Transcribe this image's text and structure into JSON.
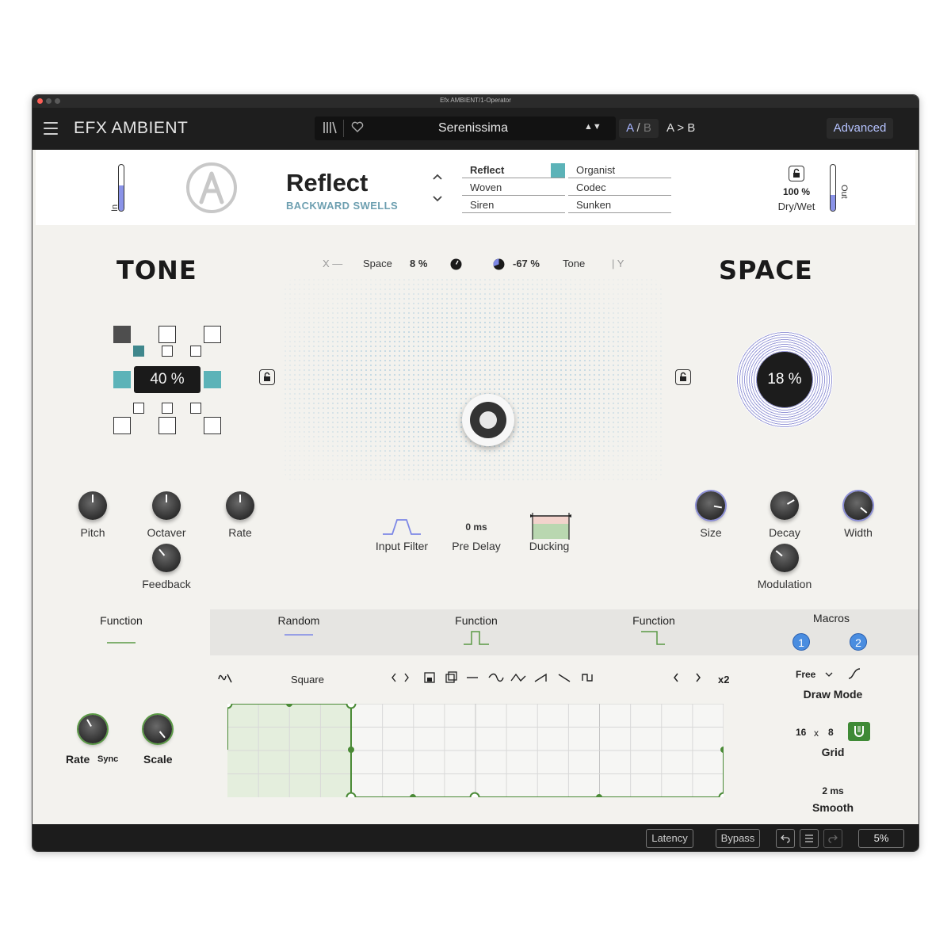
{
  "window": {
    "title": "Efx AMBIENT/1-Operator"
  },
  "topbar": {
    "app_title_prefix": "EFX",
    "app_title_name": "AMBIENT",
    "preset_name": "Serenissima",
    "preset_arrows": "▲▼",
    "ab_a": "A",
    "ab_sep": "/",
    "ab_b": "B",
    "a_to_b": "A > B",
    "advanced": "Advanced"
  },
  "header": {
    "in_label": "In",
    "in_level": 0.55,
    "mode_name": "Reflect",
    "mode_sub": "BACKWARD SWELLS",
    "mode_up": "˄",
    "mode_down": "˅",
    "modes_left": [
      "Reflect",
      "Woven",
      "Siren"
    ],
    "modes_right": [
      "Organist",
      "Codec",
      "Sunken"
    ],
    "selected_mode": "Reflect",
    "drywet_value": "100 %",
    "drywet_label": "Dry/Wet",
    "out_label": "Out",
    "out_level": 0.35
  },
  "main": {
    "tone_title": "TONE",
    "space_title": "SPACE",
    "xy": {
      "x_label": "X —",
      "space_label": "Space",
      "space_value": "8 %",
      "tone_value": "-67 %",
      "tone_label": "Tone",
      "y_label": "| Y"
    },
    "tone_value": "40 %",
    "space_value": "18 %",
    "tone_knobs": [
      {
        "label": "Pitch"
      },
      {
        "label": "Octaver"
      },
      {
        "label": "Rate"
      },
      {
        "label": "Feedback"
      }
    ],
    "middle": {
      "input_filter": "Input Filter",
      "predelay_value": "0 ms",
      "predelay_label": "Pre Delay",
      "ducking": "Ducking"
    },
    "space_knobs": [
      {
        "label": "Size"
      },
      {
        "label": "Decay"
      },
      {
        "label": "Width"
      },
      {
        "label": "Modulation"
      }
    ]
  },
  "modulation": {
    "tabs": [
      "Function",
      "Random",
      "Function",
      "Function"
    ],
    "macros_label": "Macros",
    "macro_1": "1",
    "macro_2": "2",
    "shape_name": "Square",
    "prev": "‹",
    "next": "›",
    "multiplier": "x2",
    "rate_label": "Rate",
    "sync_label": "Sync",
    "scale_label": "Scale",
    "draw_mode_value": "Free",
    "draw_mode_label": "Draw Mode",
    "grid_x": "16",
    "grid_times": "x",
    "grid_y": "8",
    "grid_label": "Grid",
    "smooth_value": "2 ms",
    "smooth_label": "Smooth"
  },
  "bottombar": {
    "latency": "Latency",
    "bypass": "Bypass",
    "cpu": "5%"
  },
  "colors": {
    "accent_teal": "#5cb3b8",
    "accent_purple": "#8c8fd6",
    "accent_green": "#4a8a36",
    "macro_blue": "#4a8de0"
  }
}
